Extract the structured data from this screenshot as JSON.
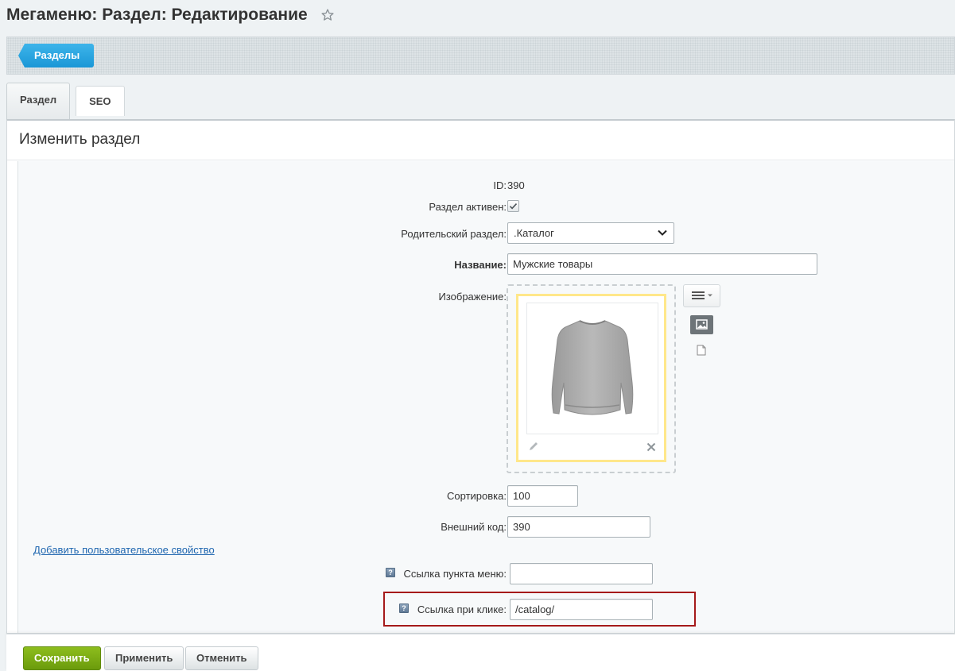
{
  "header": {
    "title": "Мегаменю: Раздел: Редактирование"
  },
  "toolbar": {
    "sections_button": "Разделы"
  },
  "tabs": [
    {
      "label": "Раздел",
      "active": true
    },
    {
      "label": "SEO",
      "active": false
    }
  ],
  "panel": {
    "heading": "Изменить раздел"
  },
  "form": {
    "id_label": "ID:",
    "id_value": "390",
    "active_label": "Раздел активен:",
    "active_checked": true,
    "parent_label": "Родительский раздел:",
    "parent_value": ".Каталог",
    "name_label": "Название:",
    "name_value": "Мужские товары",
    "image_label": "Изображение:",
    "sort_label": "Сортировка:",
    "sort_value": "100",
    "external_code_label": "Внешний код:",
    "external_code_value": "390",
    "add_property_link": "Добавить пользовательское свойство",
    "menu_link_label": "Ссылка пункта меню:",
    "menu_link_value": "",
    "click_link_label": "Ссылка при клике:",
    "click_link_value": "/catalog/"
  },
  "footer": {
    "save": "Сохранить",
    "apply": "Применить",
    "cancel": "Отменить"
  },
  "colors": {
    "accent_blue": "#1a97d6",
    "save_green": "#7aab12",
    "highlight_red": "#a51a1a",
    "image_frame_yellow": "#ffe78a"
  }
}
